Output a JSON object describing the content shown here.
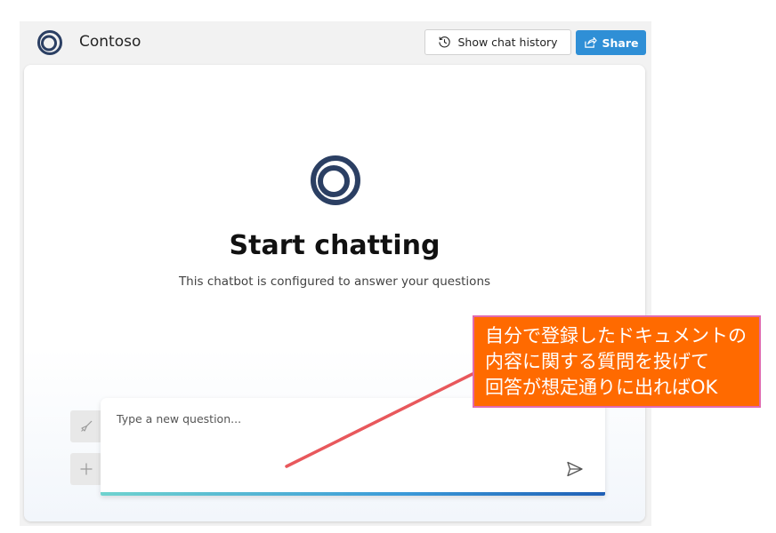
{
  "header": {
    "app_title": "Contoso",
    "logo_icon": "contoso-ring-logo",
    "history_button": {
      "label": "Show chat history",
      "icon": "history-clock-icon"
    },
    "share_button": {
      "label": "Share",
      "icon": "share-icon"
    }
  },
  "main": {
    "logo_icon": "contoso-ring-logo",
    "title": "Start chatting",
    "subtitle": "This chatbot is configured to answer your questions"
  },
  "sidebar_actions": {
    "clear_icon": "broom-icon",
    "new_chat_icon": "plus-icon"
  },
  "input": {
    "placeholder": "Type a new question...",
    "send_icon": "send-icon"
  },
  "callout": {
    "lines": [
      "自分で登録したドキュメントの",
      "内容に関する質問を投げて",
      "回答が想定通りに出ればOK"
    ]
  },
  "colors": {
    "accent": "#2f8fd6",
    "logo": "#2b3f63",
    "callout_bg": "#ff6a00",
    "callout_border": "#e06ab0",
    "arrow": "#e8585c"
  }
}
